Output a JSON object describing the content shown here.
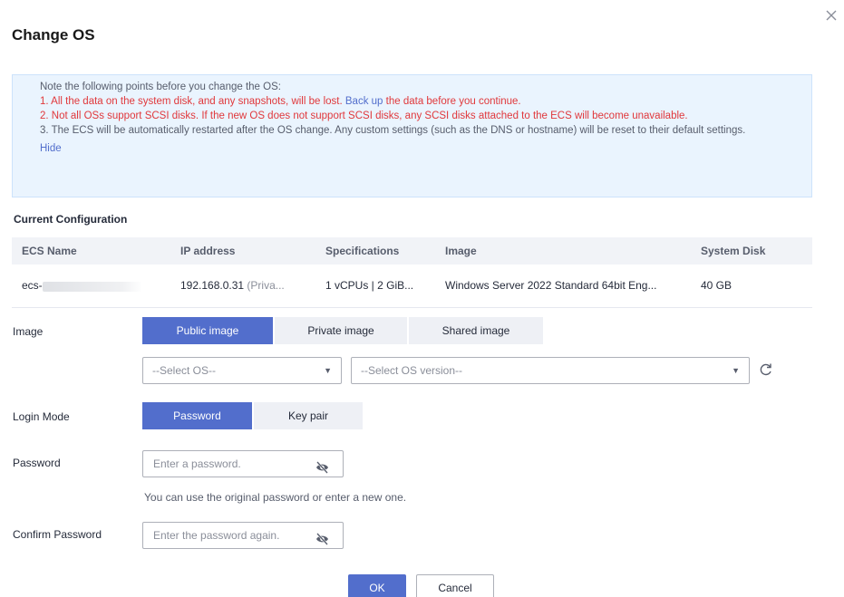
{
  "dialog": {
    "title": "Change OS"
  },
  "notice": {
    "intro": "Note the following points before you change the OS:",
    "item1_red": "1. All the data on the system disk, and any snapshots, will be lost.",
    "item1_link": "Back up",
    "item1_rest": "the data before you continue.",
    "item2_red": "2. Not all OSs support SCSI disks. If the new OS does not support SCSI disks, any SCSI disks attached to the ECS will become unavailable.",
    "item3": "3. The ECS will be automatically restarted after the OS change. Any custom settings (such as the DNS or hostname) will be reset to their default settings.",
    "hide": "Hide"
  },
  "current_config": {
    "title": "Current Configuration",
    "columns": [
      "ECS Name",
      "IP address",
      "Specifications",
      "Image",
      "System Disk"
    ],
    "row": {
      "ecs_name": "ecs-",
      "ip": "192.168.0.31",
      "ip_suffix": "(Priva...",
      "specs": "1 vCPUs | 2 GiB...",
      "image": "Windows Server 2022 Standard 64bit Eng...",
      "system_disk": "40 GB"
    }
  },
  "image": {
    "label": "Image",
    "tabs": [
      "Public image",
      "Private image",
      "Shared image"
    ],
    "active_tab": "Public image",
    "os_placeholder": "--Select OS--",
    "version_placeholder": "--Select OS version--"
  },
  "login": {
    "label": "Login Mode",
    "tabs": [
      "Password",
      "Key pair"
    ],
    "active_tab": "Password"
  },
  "password": {
    "label": "Password",
    "placeholder": "Enter a password.",
    "hint": "You can use the original password or enter a new one."
  },
  "confirm": {
    "label": "Confirm Password",
    "placeholder": "Enter the password again."
  },
  "footer": {
    "ok": "OK",
    "cancel": "Cancel"
  },
  "colors": {
    "primary": "#526ecc",
    "danger": "#e0383b",
    "notice_bg": "#eaf4fe",
    "header_bg": "#f1f3f7"
  }
}
